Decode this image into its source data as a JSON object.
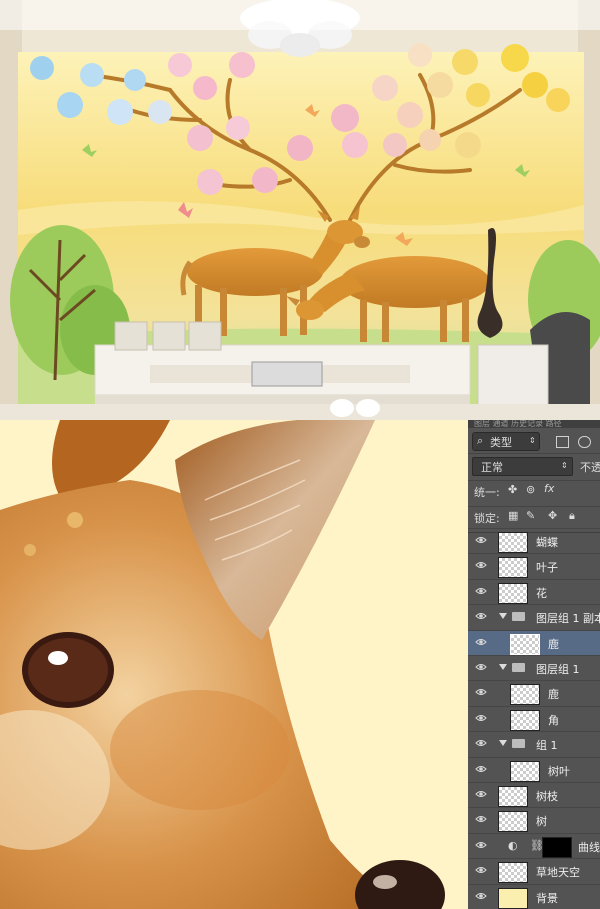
{
  "layers_panel": {
    "tabs_text": "图层  通道  历史记录  路径",
    "filter_kind": "类型",
    "blend_mode": "正常",
    "opacity_label": "不透",
    "unify_label": "统一:",
    "lock_label": "锁定:",
    "layers": [
      {
        "name": "蝴蝶",
        "type": "layer",
        "indent": 0,
        "selected": false
      },
      {
        "name": "叶子",
        "type": "layer",
        "indent": 0,
        "selected": false
      },
      {
        "name": "花",
        "type": "layer",
        "indent": 0,
        "selected": false
      },
      {
        "name": "图层组 1 副本",
        "type": "group",
        "indent": 0,
        "selected": false
      },
      {
        "name": "鹿",
        "type": "layer",
        "indent": 1,
        "selected": true
      },
      {
        "name": "图层组 1",
        "type": "group",
        "indent": 0,
        "selected": false
      },
      {
        "name": "鹿",
        "type": "layer",
        "indent": 1,
        "selected": false
      },
      {
        "name": "角",
        "type": "layer",
        "indent": 1,
        "selected": false
      },
      {
        "name": "组 1",
        "type": "group",
        "indent": 0,
        "selected": false
      },
      {
        "name": "树叶",
        "type": "layer",
        "indent": 1,
        "selected": false
      },
      {
        "name": "树枝",
        "type": "layer",
        "indent": 0,
        "selected": false
      },
      {
        "name": "树",
        "type": "layer",
        "indent": 0,
        "selected": false
      },
      {
        "name": "曲线",
        "type": "adjustment",
        "indent": 0,
        "selected": false
      },
      {
        "name": "草地天空",
        "type": "layer",
        "indent": 0,
        "selected": false
      },
      {
        "name": "背景",
        "type": "background",
        "indent": 0,
        "selected": false
      }
    ]
  },
  "colors": {
    "panel_bg": "#535353",
    "selected_row": "#576a86",
    "sky_yellow": "#f8e48c",
    "deer_orange": "#d9902f",
    "closeup_bg": "#fff3c8"
  }
}
